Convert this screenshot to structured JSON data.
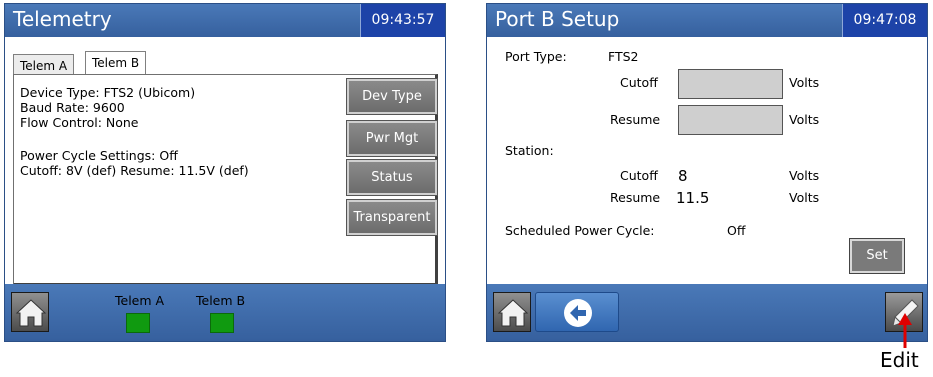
{
  "left_screen": {
    "title": "Telemetry",
    "time": "09:43:57",
    "tabs": [
      {
        "label": "Telem A"
      },
      {
        "label": "Telem B"
      }
    ],
    "info_lines": [
      "Device Type: FTS2 (Ubicom)",
      "Baud Rate: 9600",
      "Flow Control: None",
      "Power Cycle Settings: Off",
      "Cutoff: 8V (def) Resume: 11.5V (def)"
    ],
    "side_buttons": [
      {
        "label": "Dev Type"
      },
      {
        "label": "Pwr Mgt"
      },
      {
        "label": "Status"
      },
      {
        "label": "Transparent"
      }
    ],
    "indicators": [
      {
        "label": "Telem A",
        "color": "#109a10"
      },
      {
        "label": "Telem B",
        "color": "#109a10"
      }
    ]
  },
  "right_screen": {
    "title": "Port B Setup",
    "time": "09:47:08",
    "port_type_label": "Port Type:",
    "port_type_value": "FTS2",
    "cutoff_label": "Cutoff",
    "resume_label": "Resume",
    "volts": "Volts",
    "station_label": "Station:",
    "station_cutoff_label": "Cutoff",
    "station_cutoff_value": "8",
    "station_resume_label": "Resume",
    "station_resume_value": "11.5",
    "scheduled_label": "Scheduled Power Cycle:",
    "scheduled_value": "Off",
    "set_button": "Set"
  },
  "callout": {
    "label": "Edit",
    "color": "#e00000"
  },
  "colors": {
    "title_bar": "#36609e",
    "clock_bg": "#1d43a8",
    "led_green": "#109a10"
  }
}
